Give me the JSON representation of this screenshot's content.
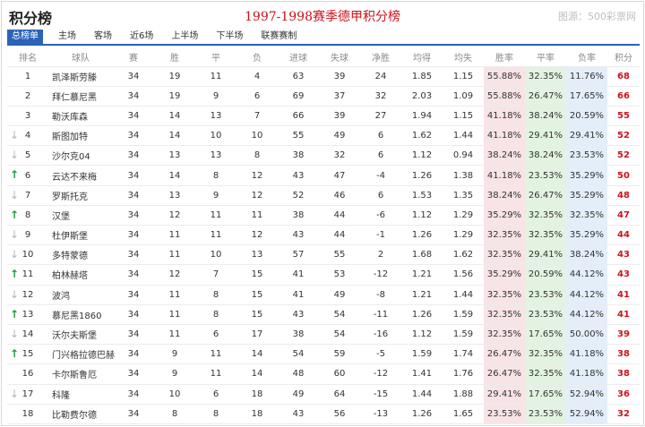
{
  "header": {
    "title": "积分榜",
    "season_title": "1997-1998赛季德甲积分榜",
    "watermark": "图源：500彩票网"
  },
  "tabs": [
    {
      "label": "总榜单",
      "active": true
    },
    {
      "label": "主场",
      "active": false
    },
    {
      "label": "客场",
      "active": false
    },
    {
      "label": "近6场",
      "active": false
    },
    {
      "label": "上半场",
      "active": false
    },
    {
      "label": "下半场",
      "active": false
    },
    {
      "label": "联赛赛制",
      "active": false
    }
  ],
  "colors": {
    "accent": "#2b63b8",
    "title_red": "#d0101a",
    "up_arrow": "#1a9c3e",
    "down_arrow": "#b5b5b5",
    "win_bg": "#f8e4e6",
    "draw_bg": "#e3f3e1",
    "loss_bg": "#e4eefa"
  },
  "table": {
    "headers": [
      "排名",
      "球队",
      "赛",
      "胜",
      "平",
      "负",
      "进球",
      "失球",
      "净胜",
      "均得",
      "均失",
      "胜率",
      "平率",
      "负率",
      "积分"
    ],
    "rows": [
      {
        "rank": "1",
        "trend": "",
        "team": "凯泽斯劳滕",
        "p": "34",
        "w": "19",
        "d": "11",
        "l": "4",
        "gf": "63",
        "ga": "39",
        "gd": "24",
        "avg_f": "1.85",
        "avg_a": "1.15",
        "win_rate": "55.88%",
        "draw_rate": "32.35%",
        "loss_rate": "11.76%",
        "pts": "68"
      },
      {
        "rank": "2",
        "trend": "",
        "team": "拜仁慕尼黑",
        "p": "34",
        "w": "19",
        "d": "9",
        "l": "6",
        "gf": "69",
        "ga": "37",
        "gd": "32",
        "avg_f": "2.03",
        "avg_a": "1.09",
        "win_rate": "55.88%",
        "draw_rate": "26.47%",
        "loss_rate": "17.65%",
        "pts": "66"
      },
      {
        "rank": "3",
        "trend": "",
        "team": "勒沃库森",
        "p": "34",
        "w": "14",
        "d": "13",
        "l": "7",
        "gf": "66",
        "ga": "39",
        "gd": "27",
        "avg_f": "1.94",
        "avg_a": "1.15",
        "win_rate": "41.18%",
        "draw_rate": "38.24%",
        "loss_rate": "20.59%",
        "pts": "55"
      },
      {
        "rank": "4",
        "trend": "down",
        "team": "斯图加特",
        "p": "34",
        "w": "14",
        "d": "10",
        "l": "10",
        "gf": "55",
        "ga": "49",
        "gd": "6",
        "avg_f": "1.62",
        "avg_a": "1.44",
        "win_rate": "41.18%",
        "draw_rate": "29.41%",
        "loss_rate": "29.41%",
        "pts": "52"
      },
      {
        "rank": "5",
        "trend": "down",
        "team": "沙尔克04",
        "p": "34",
        "w": "13",
        "d": "13",
        "l": "8",
        "gf": "38",
        "ga": "32",
        "gd": "6",
        "avg_f": "1.12",
        "avg_a": "0.94",
        "win_rate": "38.24%",
        "draw_rate": "38.24%",
        "loss_rate": "23.53%",
        "pts": "52"
      },
      {
        "rank": "6",
        "trend": "up",
        "team": "云达不来梅",
        "p": "34",
        "w": "14",
        "d": "8",
        "l": "12",
        "gf": "43",
        "ga": "47",
        "gd": "-4",
        "avg_f": "1.26",
        "avg_a": "1.38",
        "win_rate": "41.18%",
        "draw_rate": "23.53%",
        "loss_rate": "35.29%",
        "pts": "50"
      },
      {
        "rank": "7",
        "trend": "down",
        "team": "罗斯托克",
        "p": "34",
        "w": "13",
        "d": "9",
        "l": "12",
        "gf": "52",
        "ga": "46",
        "gd": "6",
        "avg_f": "1.53",
        "avg_a": "1.35",
        "win_rate": "38.24%",
        "draw_rate": "26.47%",
        "loss_rate": "35.29%",
        "pts": "48"
      },
      {
        "rank": "8",
        "trend": "up",
        "team": "汉堡",
        "p": "34",
        "w": "12",
        "d": "11",
        "l": "11",
        "gf": "38",
        "ga": "44",
        "gd": "-6",
        "avg_f": "1.12",
        "avg_a": "1.29",
        "win_rate": "35.29%",
        "draw_rate": "32.35%",
        "loss_rate": "32.35%",
        "pts": "47"
      },
      {
        "rank": "9",
        "trend": "down",
        "team": "杜伊斯堡",
        "p": "34",
        "w": "11",
        "d": "11",
        "l": "12",
        "gf": "43",
        "ga": "44",
        "gd": "-1",
        "avg_f": "1.26",
        "avg_a": "1.29",
        "win_rate": "32.35%",
        "draw_rate": "32.35%",
        "loss_rate": "35.29%",
        "pts": "44"
      },
      {
        "rank": "10",
        "trend": "down",
        "team": "多特蒙德",
        "p": "34",
        "w": "11",
        "d": "10",
        "l": "13",
        "gf": "57",
        "ga": "55",
        "gd": "2",
        "avg_f": "1.68",
        "avg_a": "1.62",
        "win_rate": "32.35%",
        "draw_rate": "29.41%",
        "loss_rate": "38.24%",
        "pts": "43"
      },
      {
        "rank": "11",
        "trend": "up",
        "team": "柏林赫塔",
        "p": "34",
        "w": "12",
        "d": "7",
        "l": "15",
        "gf": "41",
        "ga": "53",
        "gd": "-12",
        "avg_f": "1.21",
        "avg_a": "1.56",
        "win_rate": "35.29%",
        "draw_rate": "20.59%",
        "loss_rate": "44.12%",
        "pts": "43"
      },
      {
        "rank": "12",
        "trend": "down",
        "team": "波鸿",
        "p": "34",
        "w": "11",
        "d": "8",
        "l": "15",
        "gf": "41",
        "ga": "49",
        "gd": "-8",
        "avg_f": "1.21",
        "avg_a": "1.44",
        "win_rate": "32.35%",
        "draw_rate": "23.53%",
        "loss_rate": "44.12%",
        "pts": "41"
      },
      {
        "rank": "13",
        "trend": "up",
        "team": "慕尼黑1860",
        "p": "34",
        "w": "11",
        "d": "8",
        "l": "15",
        "gf": "43",
        "ga": "54",
        "gd": "-11",
        "avg_f": "1.26",
        "avg_a": "1.59",
        "win_rate": "32.35%",
        "draw_rate": "23.53%",
        "loss_rate": "44.12%",
        "pts": "41"
      },
      {
        "rank": "14",
        "trend": "down",
        "team": "沃尔夫斯堡",
        "p": "34",
        "w": "11",
        "d": "6",
        "l": "17",
        "gf": "38",
        "ga": "54",
        "gd": "-16",
        "avg_f": "1.12",
        "avg_a": "1.59",
        "win_rate": "32.35%",
        "draw_rate": "17.65%",
        "loss_rate": "50.00%",
        "pts": "39"
      },
      {
        "rank": "15",
        "trend": "up",
        "team": "门兴格拉德巴赫",
        "p": "34",
        "w": "9",
        "d": "11",
        "l": "14",
        "gf": "54",
        "ga": "59",
        "gd": "-5",
        "avg_f": "1.59",
        "avg_a": "1.74",
        "win_rate": "26.47%",
        "draw_rate": "32.35%",
        "loss_rate": "41.18%",
        "pts": "38"
      },
      {
        "rank": "16",
        "trend": "",
        "team": "卡尔斯鲁厄",
        "p": "34",
        "w": "9",
        "d": "11",
        "l": "14",
        "gf": "48",
        "ga": "60",
        "gd": "-12",
        "avg_f": "1.41",
        "avg_a": "1.76",
        "win_rate": "26.47%",
        "draw_rate": "32.35%",
        "loss_rate": "41.18%",
        "pts": "38"
      },
      {
        "rank": "17",
        "trend": "down",
        "team": "科隆",
        "p": "34",
        "w": "10",
        "d": "6",
        "l": "18",
        "gf": "49",
        "ga": "64",
        "gd": "-15",
        "avg_f": "1.44",
        "avg_a": "1.88",
        "win_rate": "29.41%",
        "draw_rate": "17.65%",
        "loss_rate": "52.94%",
        "pts": "36"
      },
      {
        "rank": "18",
        "trend": "",
        "team": "比勒费尔德",
        "p": "34",
        "w": "8",
        "d": "8",
        "l": "18",
        "gf": "43",
        "ga": "56",
        "gd": "-13",
        "avg_f": "1.26",
        "avg_a": "1.65",
        "win_rate": "23.53%",
        "draw_rate": "23.53%",
        "loss_rate": "52.94%",
        "pts": "32"
      }
    ]
  }
}
